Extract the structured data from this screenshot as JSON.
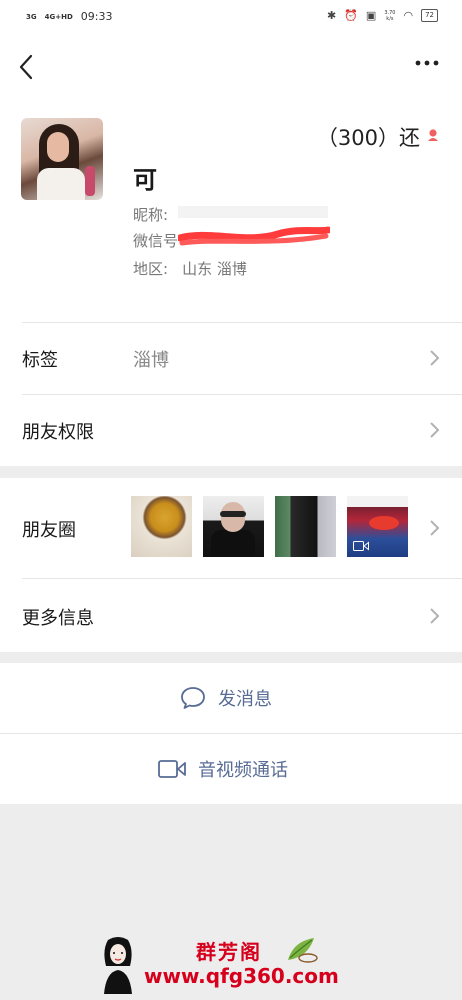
{
  "status_bar": {
    "signal_1": "3G",
    "signal_2": "4G+HD",
    "time": "09:33",
    "speed_top": "3.70",
    "speed_bottom": "k/s",
    "battery": "72"
  },
  "profile": {
    "remark": "（300）还",
    "display_name": "可",
    "nickname_label": "昵称:",
    "wechat_id_label": "微信号",
    "region_label": "地区:",
    "region_value": "山东  淄博"
  },
  "rows": {
    "tags_label": "标签",
    "tags_value": "淄博",
    "permissions_label": "朋友权限",
    "moments_label": "朋友圈",
    "more_info_label": "更多信息"
  },
  "actions": {
    "message_label": "发消息",
    "call_label": "音视频通话"
  },
  "watermark": {
    "title": "群芳阁",
    "url": "www.qfg360.com"
  },
  "colors": {
    "link_blue": "#576b95",
    "watermark_red": "#d6001c",
    "page_bg": "#ededed"
  },
  "icons": {
    "back": "chevron-left-icon",
    "more": "more-dots-icon",
    "gender": "female-icon",
    "chevron": "chevron-right-icon",
    "message": "chat-bubble-icon",
    "call": "video-camera-icon"
  }
}
